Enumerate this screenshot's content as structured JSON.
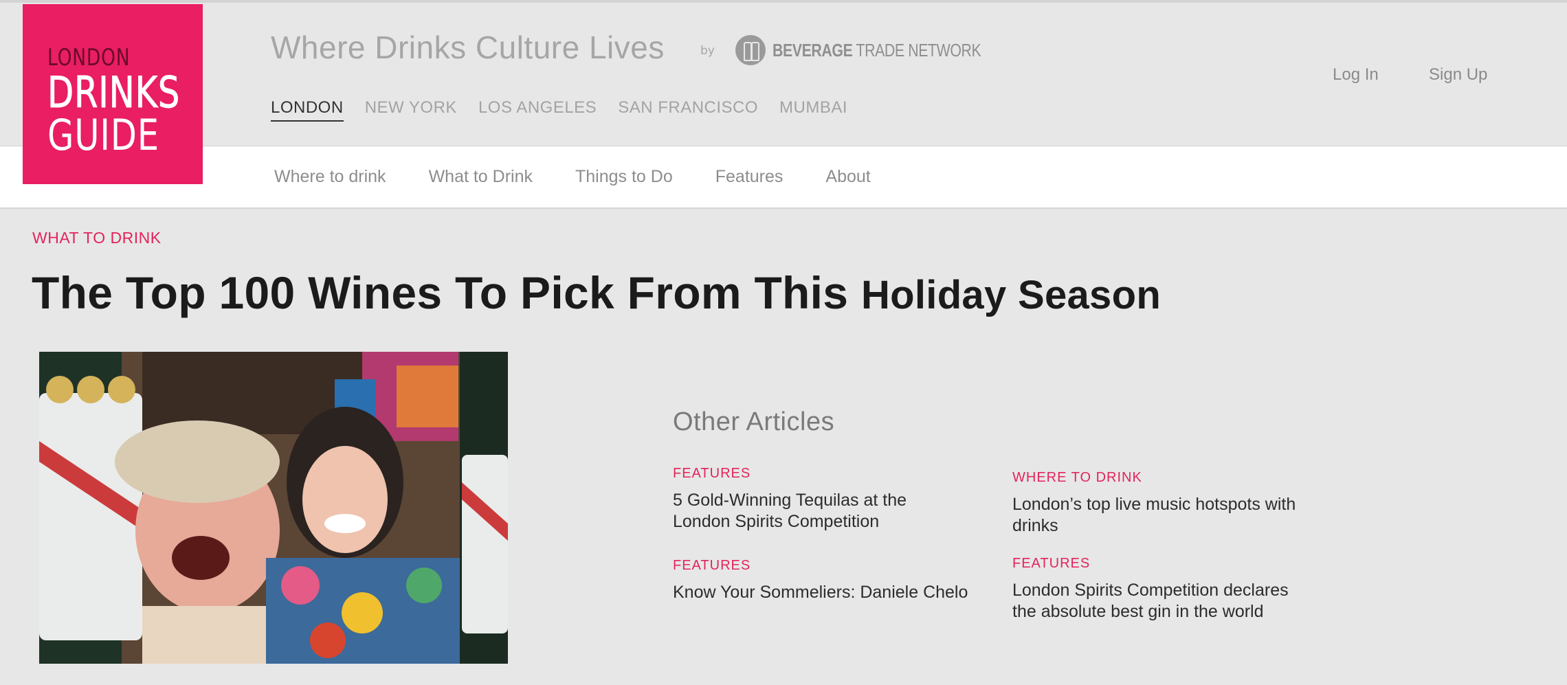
{
  "logo": {
    "line1": "LONDON",
    "line2": "DRINKS",
    "line3": "GUIDE"
  },
  "header": {
    "tagline": "Where Drinks Culture Lives",
    "by": "by",
    "partner_bold": "BEVERAGE",
    "partner_rest": " TRADE NETWORK",
    "cities": [
      "LONDON",
      "NEW YORK",
      "LOS ANGELES",
      "SAN FRANCISCO",
      "MUMBAI"
    ],
    "active_city": "LONDON",
    "login": "Log In",
    "signup": "Sign Up"
  },
  "nav": [
    "Where to drink",
    "What to Drink",
    "Things to Do",
    "Features",
    "About"
  ],
  "article": {
    "category": "WHAT TO DRINK",
    "title_main": "The Top 100 Wines To Pick From This ",
    "title_tail": "Holiday Season"
  },
  "other": {
    "title": "Other Articles",
    "items": [
      {
        "category": "FEATURES",
        "title": "5 Gold-Winning Tequilas at the London Spirits Competition"
      },
      {
        "category": "WHERE TO DRINK",
        "title": "London’s top live music hotspots with drinks"
      },
      {
        "category": "FEATURES",
        "title": "Know Your Sommeliers: Daniele Chelo"
      },
      {
        "category": "FEATURES",
        "title": "London Spirits Competition declares the absolute best gin in the world"
      }
    ]
  },
  "colors": {
    "brand_pink": "#e91e63",
    "accent": "#e2245c",
    "background": "#e7e7e7"
  },
  "icons": [
    "beverage-trade-network-bottles-icon"
  ]
}
